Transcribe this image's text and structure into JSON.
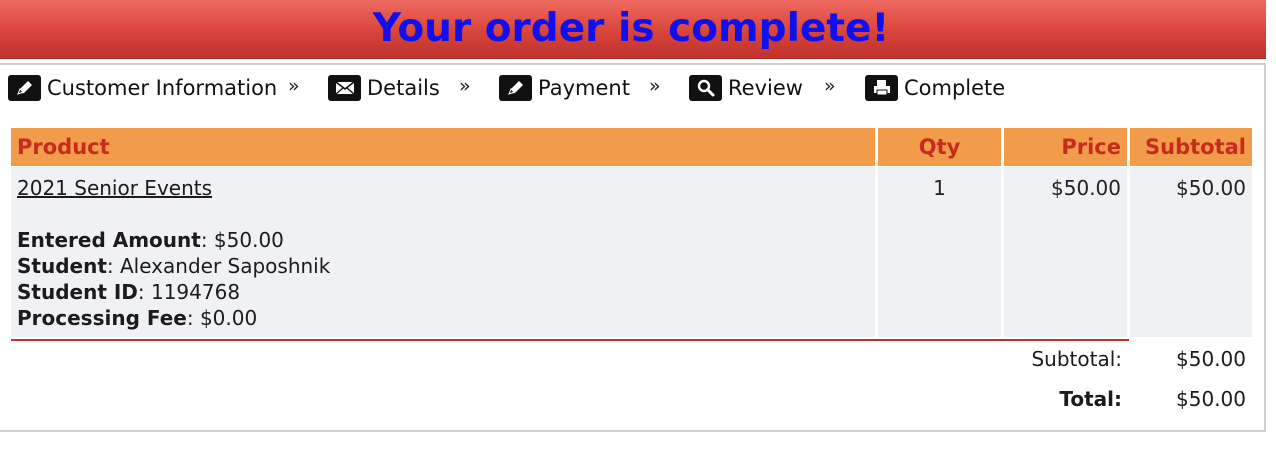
{
  "banner": {
    "title": "Your order is complete!"
  },
  "steps": [
    {
      "label": "Customer Information",
      "icon": "pencil-icon"
    },
    {
      "label": "Details",
      "icon": "envelope-icon"
    },
    {
      "label": "Payment",
      "icon": "pencil-icon"
    },
    {
      "label": "Review",
      "icon": "magnifier-icon"
    },
    {
      "label": "Complete",
      "icon": "printer-icon"
    }
  ],
  "step_separator": "»",
  "table": {
    "headers": {
      "product": "Product",
      "qty": "Qty",
      "price": "Price",
      "subtotal": "Subtotal"
    },
    "rows": [
      {
        "product": "2021 Senior Events",
        "qty": "1",
        "price": "$50.00",
        "subtotal": "$50.00",
        "details": [
          {
            "label": "Entered Amount",
            "value": ": $50.00"
          },
          {
            "label": "Student",
            "value": ": Alexander Saposhnik"
          },
          {
            "label": "Student ID",
            "value": ": 1194768"
          },
          {
            "label": "Processing Fee",
            "value": ": $0.00"
          }
        ]
      }
    ]
  },
  "totals": {
    "subtotal_label": "Subtotal:",
    "subtotal_value": "$50.00",
    "total_label": "Total:",
    "total_value": "$50.00"
  },
  "colors": {
    "banner_red": "#d8443a",
    "title_blue": "#1010ee",
    "header_orange": "#f29b4b",
    "header_text": "#c62b1d",
    "row_bg": "#f0f1f5"
  }
}
